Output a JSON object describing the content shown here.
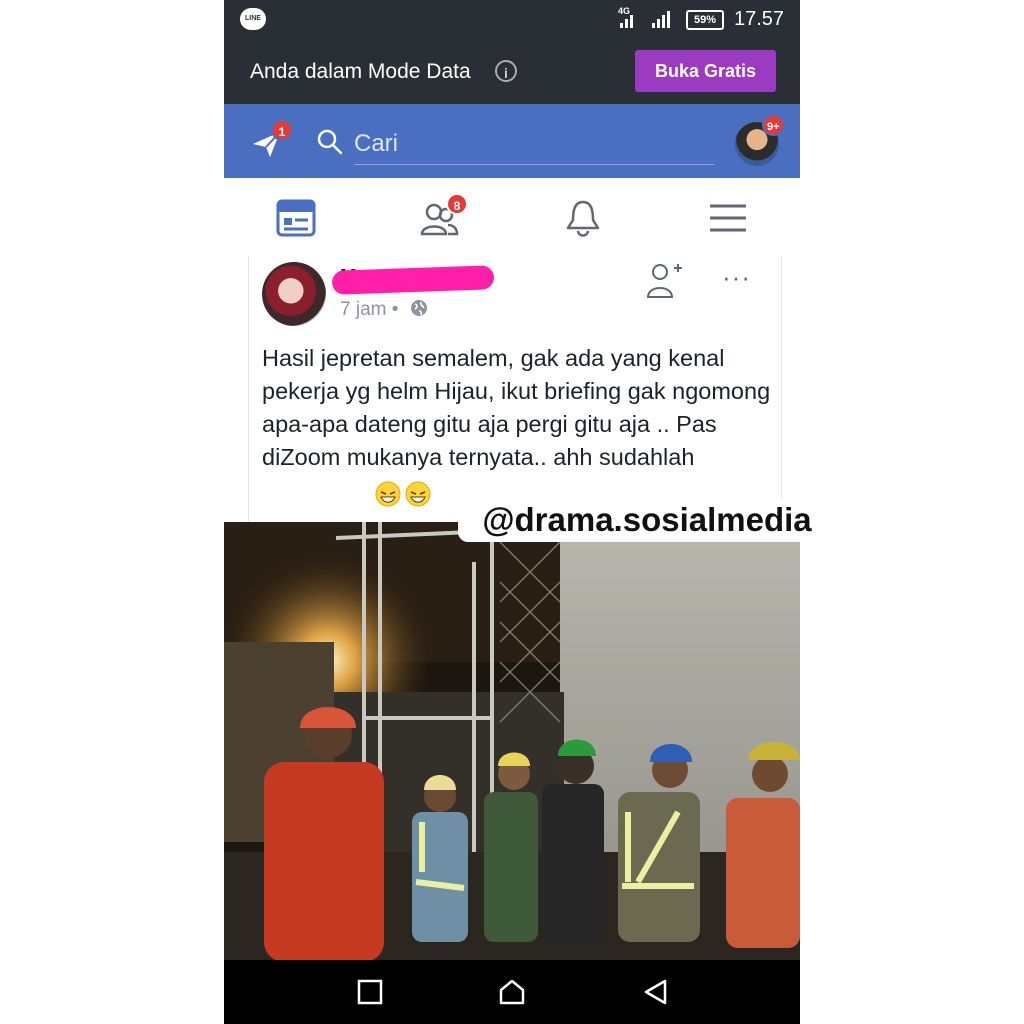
{
  "status_bar": {
    "app_icon": "LINE",
    "network": "4G",
    "battery": "59%",
    "time": "17.57"
  },
  "mode_bar": {
    "text": "Anda dalam Mode Data",
    "button": "Buka Gratis"
  },
  "header": {
    "search_placeholder": "Cari",
    "messages_badge": "1",
    "profile_badge": "9+"
  },
  "tabs": {
    "friends_badge": "8"
  },
  "post": {
    "author": "M",
    "time": "7 jam",
    "separator": "•",
    "text": "Hasil jepretan semalem, gak ada yang kenal pekerja yg helm Hijau, ikut briefing gak ngomong apa-apa dateng gitu aja pergi gitu aja ..  Pas diZoom mukanya ternyata.. ahh sudahlah",
    "more": "···"
  },
  "watermark": "@drama.sosialmedia",
  "colors": {
    "fb_blue": "#4a6ec0",
    "status_bg": "#2a2e35",
    "buka_purple": "#9b3bc2",
    "badge_red": "#e53935",
    "redaction_pink": "#ff1fa8"
  },
  "icons": [
    "line-app-icon",
    "info-icon",
    "messenger-icon",
    "search-icon",
    "news-feed-icon",
    "friends-icon",
    "bell-icon",
    "menu-icon",
    "globe-icon",
    "add-friend-icon",
    "more-options-icon",
    "recent-apps-icon",
    "home-icon",
    "back-icon"
  ]
}
